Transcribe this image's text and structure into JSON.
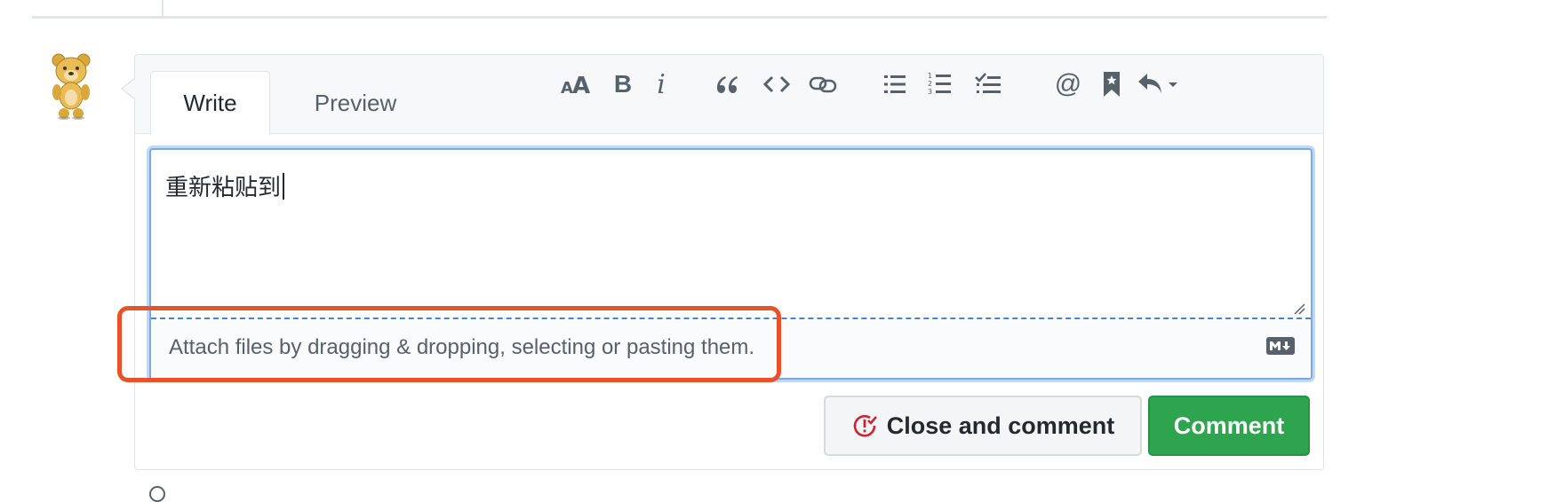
{
  "tabs": {
    "write": "Write",
    "preview": "Preview"
  },
  "toolbar": {
    "heading_icon": "text-size-icon",
    "bold_label": "B",
    "italic_label": "i",
    "mention_label": "@",
    "items": [
      "text-size-icon",
      "bold-icon",
      "italic-icon",
      "quote-icon",
      "code-icon",
      "link-icon",
      "unordered-list-icon",
      "ordered-list-icon",
      "task-list-icon",
      "mention-icon",
      "saved-reply-icon",
      "reply-icon"
    ]
  },
  "editor": {
    "value": "重新粘贴到",
    "attach_text": "Attach files by dragging & dropping, selecting or pasting them."
  },
  "buttons": {
    "close_and_comment": "Close and comment",
    "comment": "Comment"
  },
  "colors": {
    "accent": "#0366d6",
    "comment_green": "#2ea44f",
    "highlight": "#e8522b",
    "close_icon": "#cb2431"
  }
}
